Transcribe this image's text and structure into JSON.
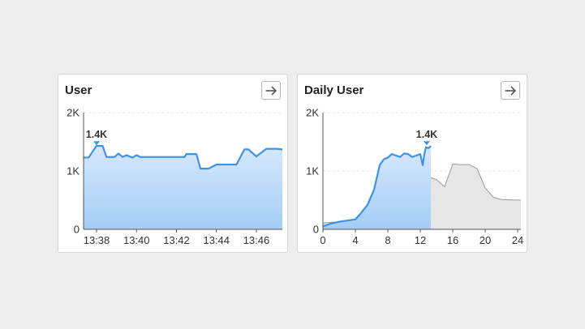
{
  "colors": {
    "series_line": "#3f92e6",
    "series_fill_top": "#d6e8fb",
    "series_fill_bottom": "#a5cdf5",
    "compare_line": "#9a9a9a",
    "compare_fill": "#e6e6e6",
    "axis": "#555555",
    "grid": "#e8e8e8"
  },
  "cards": {
    "user": {
      "title": "User",
      "open_icon": "arrow-right-icon"
    },
    "daily_user": {
      "title": "Daily User",
      "open_icon": "arrow-right-icon"
    }
  },
  "chart_data": [
    {
      "type": "area",
      "y_ticks": [
        {
          "value": 0,
          "label": "0"
        },
        {
          "value": 1000,
          "label": "1K"
        },
        {
          "value": 2000,
          "label": "2K"
        }
      ],
      "ylim": [
        0,
        2000
      ],
      "xlim": [
        37.35,
        47.3
      ],
      "x_ticks": [
        {
          "value": 38,
          "label": "13:38"
        },
        {
          "value": 40,
          "label": "13:40"
        },
        {
          "value": 42,
          "label": "13:42"
        },
        {
          "value": 44,
          "label": "13:44"
        },
        {
          "value": 46,
          "label": "13:46"
        }
      ],
      "grid": "horizontal dashed",
      "peak_label": {
        "x": 38.0,
        "value": 1400,
        "text": "1.4K"
      },
      "series": [
        {
          "x": [
            37.35,
            37.6,
            38.0,
            38.3,
            38.5,
            38.9,
            39.1,
            39.3,
            39.5,
            39.8,
            40.0,
            40.2,
            41.0,
            41.5,
            42.0,
            42.4,
            42.5,
            43.0,
            43.2,
            43.6,
            44.0,
            44.5,
            45.0,
            45.4,
            45.6,
            46.0,
            46.5,
            47.0,
            47.3
          ],
          "y": [
            1230,
            1230,
            1430,
            1430,
            1240,
            1240,
            1300,
            1240,
            1270,
            1230,
            1270,
            1240,
            1240,
            1240,
            1240,
            1240,
            1290,
            1290,
            1040,
            1040,
            1110,
            1110,
            1110,
            1370,
            1370,
            1250,
            1380,
            1380,
            1370
          ]
        }
      ]
    },
    {
      "type": "area",
      "y_ticks": [
        {
          "value": 0,
          "label": "0"
        },
        {
          "value": 1000,
          "label": "1K"
        },
        {
          "value": 2000,
          "label": "2K"
        }
      ],
      "ylim": [
        0,
        2000
      ],
      "xlim": [
        0,
        24.4
      ],
      "x_ticks": [
        {
          "value": 0,
          "label": "0"
        },
        {
          "value": 4,
          "label": "4"
        },
        {
          "value": 8,
          "label": "8"
        },
        {
          "value": 12,
          "label": "12"
        },
        {
          "value": 16,
          "label": "16"
        },
        {
          "value": 20,
          "label": "20"
        },
        {
          "value": 24,
          "label": "24"
        }
      ],
      "grid": "horizontal dashed",
      "peak_label": {
        "x": 12.8,
        "value": 1400,
        "text": "1.4K"
      },
      "series": [
        {
          "x": [
            0,
            1,
            2,
            3,
            4,
            4.7,
            5.5,
            6.3,
            7.0,
            7.5,
            8.0,
            8.5,
            9.5,
            10.0,
            10.5,
            11.0,
            12.0,
            12.3,
            12.5,
            12.7,
            13.0,
            13.3
          ],
          "y": [
            50,
            100,
            130,
            150,
            170,
            280,
            420,
            680,
            1100,
            1200,
            1230,
            1290,
            1240,
            1300,
            1290,
            1240,
            1290,
            1100,
            1290,
            1410,
            1390,
            1430
          ]
        },
        {
          "x": [
            0,
            2,
            4,
            5,
            6,
            7,
            8,
            9,
            10,
            11,
            12,
            13,
            14,
            15,
            16,
            17,
            18,
            19,
            20,
            21,
            22,
            24.4
          ],
          "y": [
            110,
            130,
            150,
            220,
            380,
            730,
            1000,
            1170,
            1190,
            1180,
            1100,
            900,
            850,
            730,
            1120,
            1110,
            1110,
            1040,
            710,
            550,
            510,
            500
          ]
        }
      ]
    }
  ]
}
